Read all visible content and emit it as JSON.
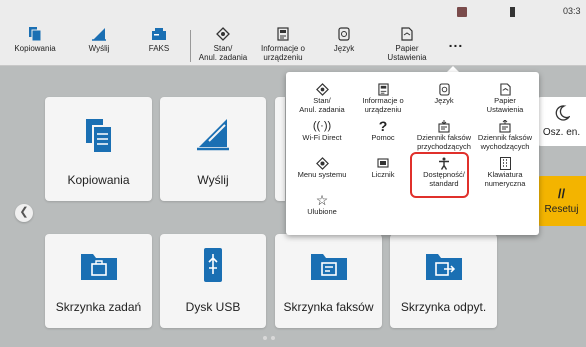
{
  "status": {
    "time": "03:3"
  },
  "topbar": {
    "items": [
      {
        "label": "Kopiowania",
        "icon": "copy-icon"
      },
      {
        "label": "Wyślij",
        "icon": "send-icon"
      },
      {
        "label": "FAKS",
        "icon": "fax-icon"
      },
      {
        "label": "Stan/\nAnul. zadania",
        "icon": "status-icon"
      },
      {
        "label": "Informacje o\nurządzeniu",
        "icon": "device-info-icon"
      },
      {
        "label": "Język",
        "icon": "language-icon"
      },
      {
        "label": "Papier\nUstawienia",
        "icon": "paper-icon"
      }
    ],
    "more": "..."
  },
  "tiles": [
    {
      "label": "Kopiowania",
      "icon": "copy-icon"
    },
    {
      "label": "Wyślij",
      "icon": "send-icon"
    },
    {
      "label": "Skrzynka zadań",
      "icon": "job-box-icon"
    },
    {
      "label": "Dysk USB",
      "icon": "usb-icon"
    },
    {
      "label": "Skrzynka faksów",
      "icon": "fax-box-icon"
    },
    {
      "label": "Skrzynka odpyt.",
      "icon": "polling-box-icon"
    }
  ],
  "side": {
    "osz": "Osz. en.",
    "reset": "Resetuj"
  },
  "popup": {
    "items": [
      {
        "label": "Stan/\nAnul. zadania",
        "icon": "status-icon"
      },
      {
        "label": "Informacje o\nurządzeniu",
        "icon": "device-info-icon"
      },
      {
        "label": "Język",
        "icon": "language-icon"
      },
      {
        "label": "Papier\nUstawienia",
        "icon": "paper-icon"
      },
      {
        "label": "Wi-Fi Direct",
        "icon": "wifi-direct-icon"
      },
      {
        "label": "Pomoc",
        "icon": "help-icon"
      },
      {
        "label": "Dziennik faksów\nprzychodzących",
        "icon": "fax-log-in-icon"
      },
      {
        "label": "Dziennik faksów\nwychodzących",
        "icon": "fax-log-out-icon"
      },
      {
        "label": "Menu systemu",
        "icon": "system-menu-icon"
      },
      {
        "label": "Licznik",
        "icon": "counter-icon"
      },
      {
        "label": "Dostępność/\nstandard",
        "icon": "accessibility-icon"
      },
      {
        "label": "Klawiatura\nnumeryczna",
        "icon": "numpad-icon"
      },
      {
        "label": "Ulubione",
        "icon": "favorites-icon"
      }
    ]
  },
  "colors": {
    "accent_blue": "#1a6fb3",
    "highlight_red": "#e0302b",
    "reset_yellow": "#f3b400"
  }
}
